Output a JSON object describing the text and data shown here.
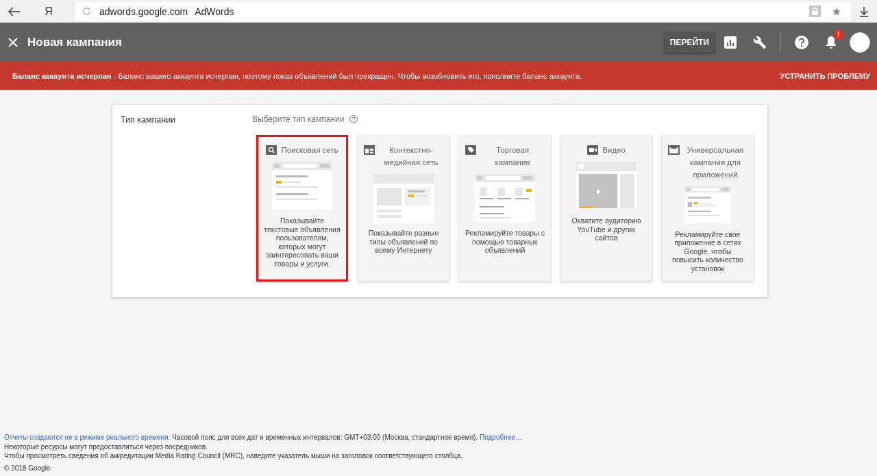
{
  "browser": {
    "yandex_logo": "Я",
    "url": "adwords.google.com",
    "page_title": "AdWords"
  },
  "header": {
    "title": "Новая кампания",
    "go_button": "ПЕРЕЙТИ",
    "notification_badge": "!"
  },
  "alert": {
    "message": "**Баланс аккаунта исчерпан** - Баланс вашего аккаунта исчерпан, поэтому показ объявлений был прекращен. Чтобы возобновить его, пополните баланс аккаунта.",
    "action": "УСТРАНИТЬ ПРОБЛЕМУ"
  },
  "campaign": {
    "section_label": "Тип кампании",
    "prompt": "Выберите тип кампании",
    "types": [
      {
        "kind": "search",
        "title": "Поисковая сеть",
        "description": "Показывайте текстовые объявления пользователям, которых могут заинтересовать ваши товары и услуги.",
        "selected": true
      },
      {
        "kind": "display",
        "title": "Контекстно-медийная сеть",
        "description": "Показывайте разные типы объявлений по всему Интернету",
        "selected": false
      },
      {
        "kind": "shopping",
        "title": "Торговая кампания",
        "description": "Рекламируйте товары с помощью товарных объявлений",
        "selected": false
      },
      {
        "kind": "video",
        "title": "Видео",
        "description": "Охватите аудиторию YouTube и других сайтов",
        "selected": false
      },
      {
        "kind": "app",
        "title": "Универсальная кампания для приложений",
        "description": "Рекламируйте свое приложение в сетях Google, чтобы повысить количество установок",
        "selected": false
      }
    ]
  },
  "footer": {
    "realtime_link": "Отчеты создаются не в режиме реального времени.",
    "timezone_text": "Часовой пояс для всех дат и временных интервалов: GMT+03:00 (Москва, стандартное время).",
    "more_link": "Подробнее…",
    "lines": [
      "Некоторые ресурсы могут предоставляться через посредников.",
      "Чтобы просмотреть сведения об аккредитации Media Rating Council (MRC), наведите указатель мыши на заголовок соответствующего столбца."
    ],
    "copyright": "© 2018 Google"
  }
}
